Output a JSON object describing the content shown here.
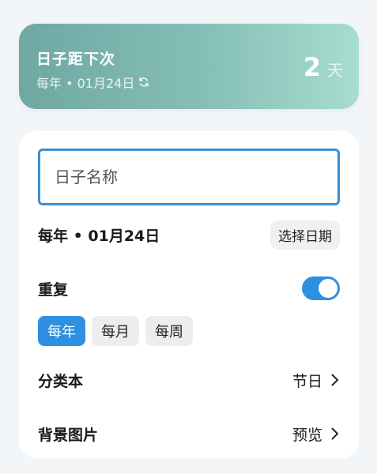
{
  "banner": {
    "title": "日子距下次",
    "subtitle": "每年 • 01月24日",
    "count": "2",
    "unit": "天"
  },
  "form": {
    "name_placeholder": "日子名称",
    "date_text": "每年 • 01月24日",
    "pick_date_label": "选择日期",
    "repeat_label": "重复",
    "repeat_enabled": true,
    "repeat_options": [
      {
        "label": "每年",
        "active": true
      },
      {
        "label": "每月",
        "active": false
      },
      {
        "label": "每周",
        "active": false
      }
    ],
    "category_label": "分类本",
    "category_value": "节日",
    "background_label": "背景图片",
    "background_value": "预览"
  },
  "colors": {
    "accent": "#2f8fe0",
    "banner_start": "#6fa7a3",
    "banner_end": "#a7ddd0"
  }
}
